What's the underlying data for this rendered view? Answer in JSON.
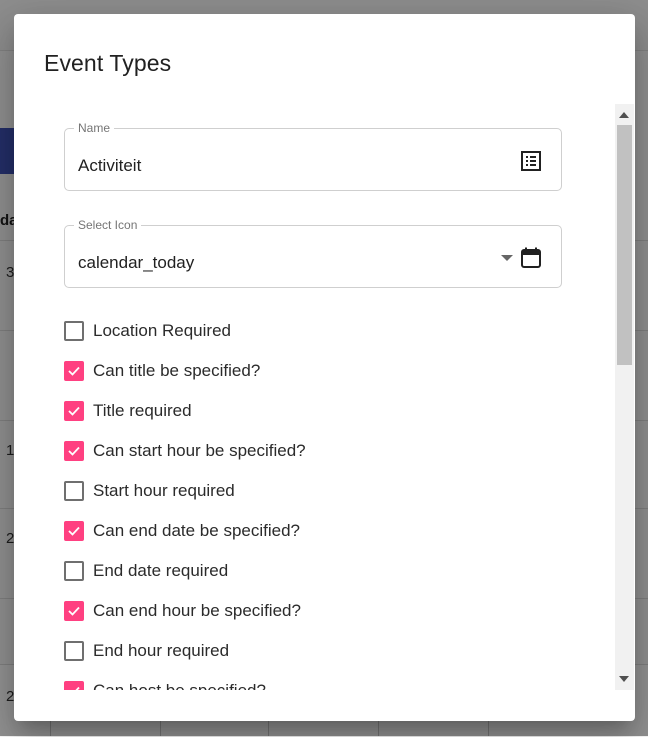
{
  "background": {
    "partial_header_text": "da",
    "row_numbers": [
      "3",
      "1",
      "2",
      "2"
    ]
  },
  "dialog": {
    "title": "Event Types",
    "name_field": {
      "label": "Name",
      "value": "Activiteit",
      "icon": "list-alt-icon"
    },
    "icon_select": {
      "label": "Select Icon",
      "value": "calendar_today",
      "icon": "calendar-today-icon"
    },
    "checkboxes": [
      {
        "label": "Location Required",
        "checked": false
      },
      {
        "label": "Can title be specified?",
        "checked": true
      },
      {
        "label": "Title required",
        "checked": true
      },
      {
        "label": "Can start hour be specified?",
        "checked": true
      },
      {
        "label": "Start hour required",
        "checked": false
      },
      {
        "label": "Can end date be specified?",
        "checked": true
      },
      {
        "label": "End date required",
        "checked": false
      },
      {
        "label": "Can end hour be specified?",
        "checked": true
      },
      {
        "label": "End hour required",
        "checked": false
      },
      {
        "label": "Can host be specified?",
        "checked": true
      }
    ]
  },
  "colors": {
    "checkbox_checked": "#ff4081",
    "checkbox_unchecked_border": "#6f6f6f",
    "primary_bg": "#3f51b5"
  }
}
